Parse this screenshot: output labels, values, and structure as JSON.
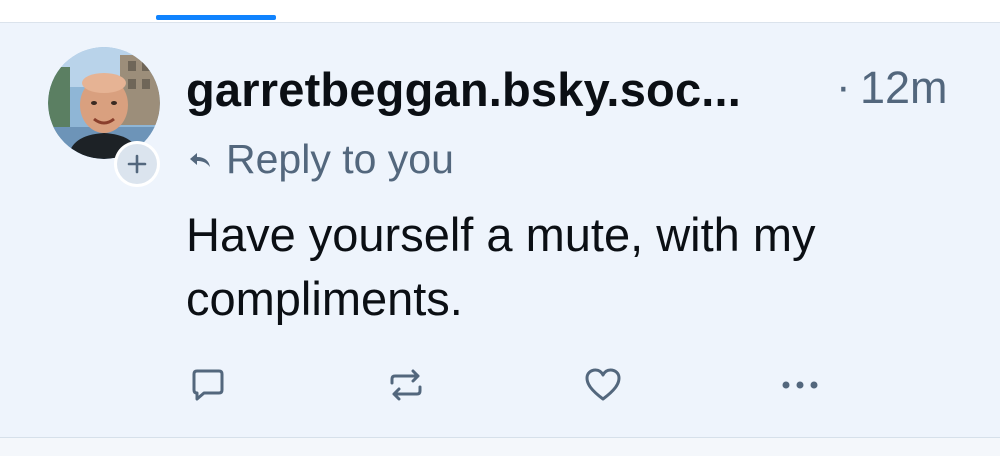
{
  "post": {
    "handle": "garretbeggan.bsky.soc...",
    "separator": "·",
    "time": "12m",
    "reply_label": "Reply to you",
    "text": "Have yourself a mute, with my compliments."
  },
  "icons": {
    "avatar": "avatar-photo",
    "follow": "plus-icon",
    "reply_indicator": "reply-arrow-icon",
    "actions": [
      "comment-icon",
      "repost-icon",
      "heart-icon",
      "more-dots-icon"
    ]
  },
  "colors": {
    "accent": "#1083fe",
    "post_background": "#eef4fc",
    "muted_text": "#53677d",
    "primary_text": "#0b0f14"
  }
}
